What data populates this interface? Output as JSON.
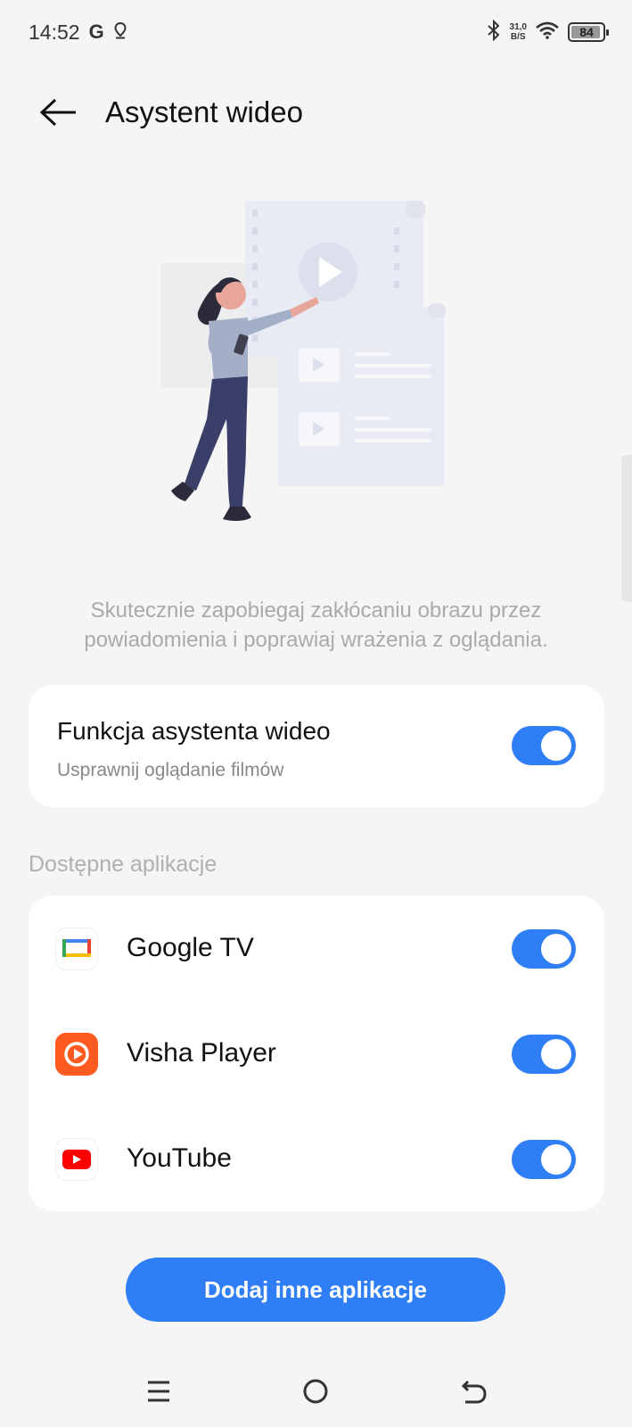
{
  "status_bar": {
    "time": "14:52",
    "google_indicator": "G",
    "speed_value": "31,0",
    "speed_unit": "B/S",
    "battery": "84",
    "icons": [
      "location-pin-icon",
      "bluetooth-icon",
      "wifi-icon",
      "battery-icon"
    ]
  },
  "header": {
    "title": "Asystent wideo",
    "back_icon": "arrow-left-icon"
  },
  "description": "Skutecznie zapobiegaj zakłócaniu obrazu przez powiadomienia i poprawiaj wrażenia z oglądania.",
  "feature": {
    "title": "Funkcja asystenta wideo",
    "subtitle": "Usprawnij oglądanie filmów",
    "enabled": true
  },
  "section_label": "Dostępne aplikacje",
  "apps": [
    {
      "name": "Google TV",
      "icon": "google-tv-icon",
      "enabled": true
    },
    {
      "name": "Visha Player",
      "icon": "visha-player-icon",
      "enabled": true
    },
    {
      "name": "YouTube",
      "icon": "youtube-icon",
      "enabled": true
    }
  ],
  "add_button": "Dodaj inne aplikacje",
  "colors": {
    "accent": "#2f7ef5",
    "background": "#f5f5f5",
    "card": "#ffffff",
    "youtube_red": "#ff0000",
    "visha_orange": "#ff5a1f"
  },
  "nav_bar": {
    "items": [
      "menu-icon",
      "home-icon",
      "back-icon"
    ]
  }
}
